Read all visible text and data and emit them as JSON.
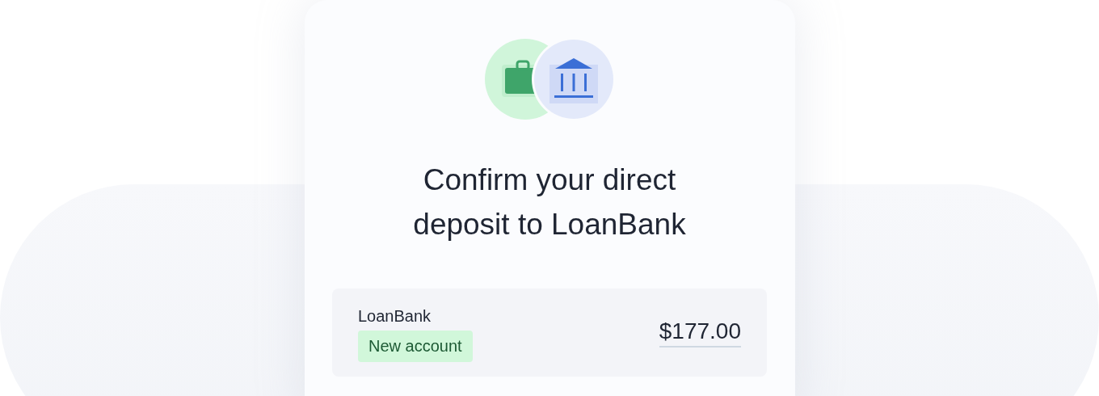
{
  "title": "Confirm your direct deposit to LoanBank",
  "account": {
    "name": "LoanBank",
    "badge": "New account",
    "amount": "$177.00"
  }
}
